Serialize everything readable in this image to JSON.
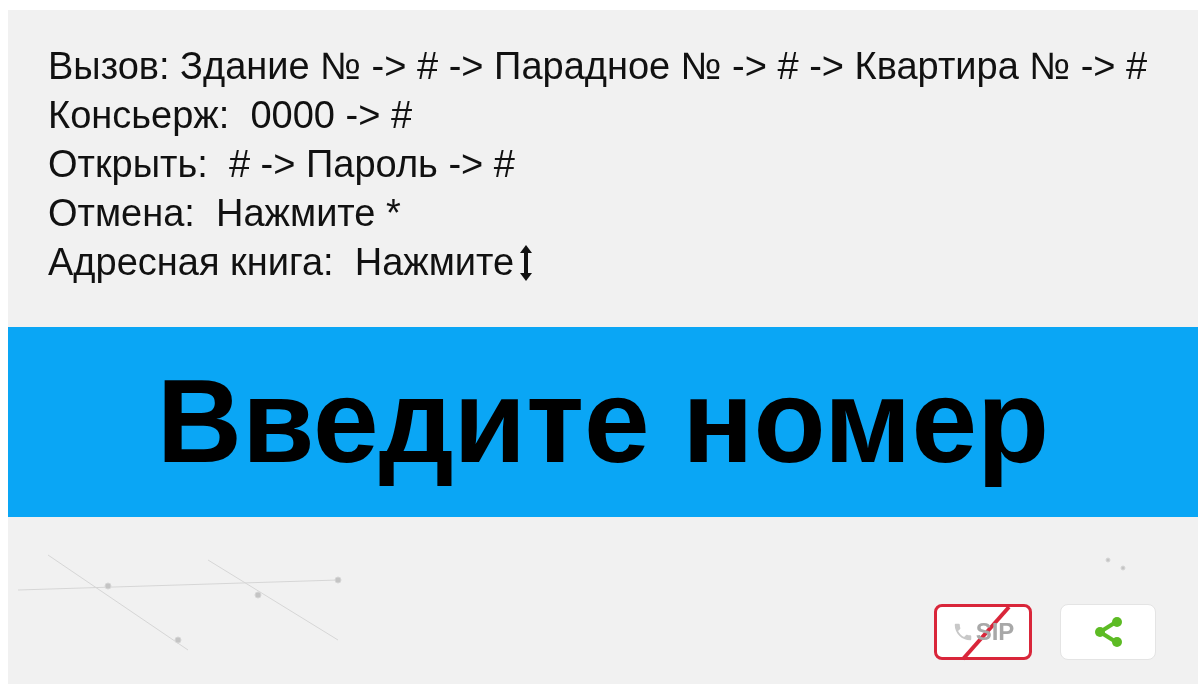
{
  "instructions": [
    {
      "text": "Вызов: Здание № -> # -> Парадное № -> # -> Квартира № -> #",
      "kind": "plain"
    },
    {
      "text": "Консьерж:  0000 -> #",
      "kind": "plain"
    },
    {
      "text": "Открыть:  # -> Пароль -> #",
      "kind": "plain"
    },
    {
      "text": "Отмена:  Нажмите *",
      "kind": "plain"
    },
    {
      "text": "Адресная книга:  Нажмите",
      "kind": "arrow"
    }
  ],
  "prompt": "Введите номер",
  "sip": {
    "label": "SIP",
    "registered": false
  }
}
